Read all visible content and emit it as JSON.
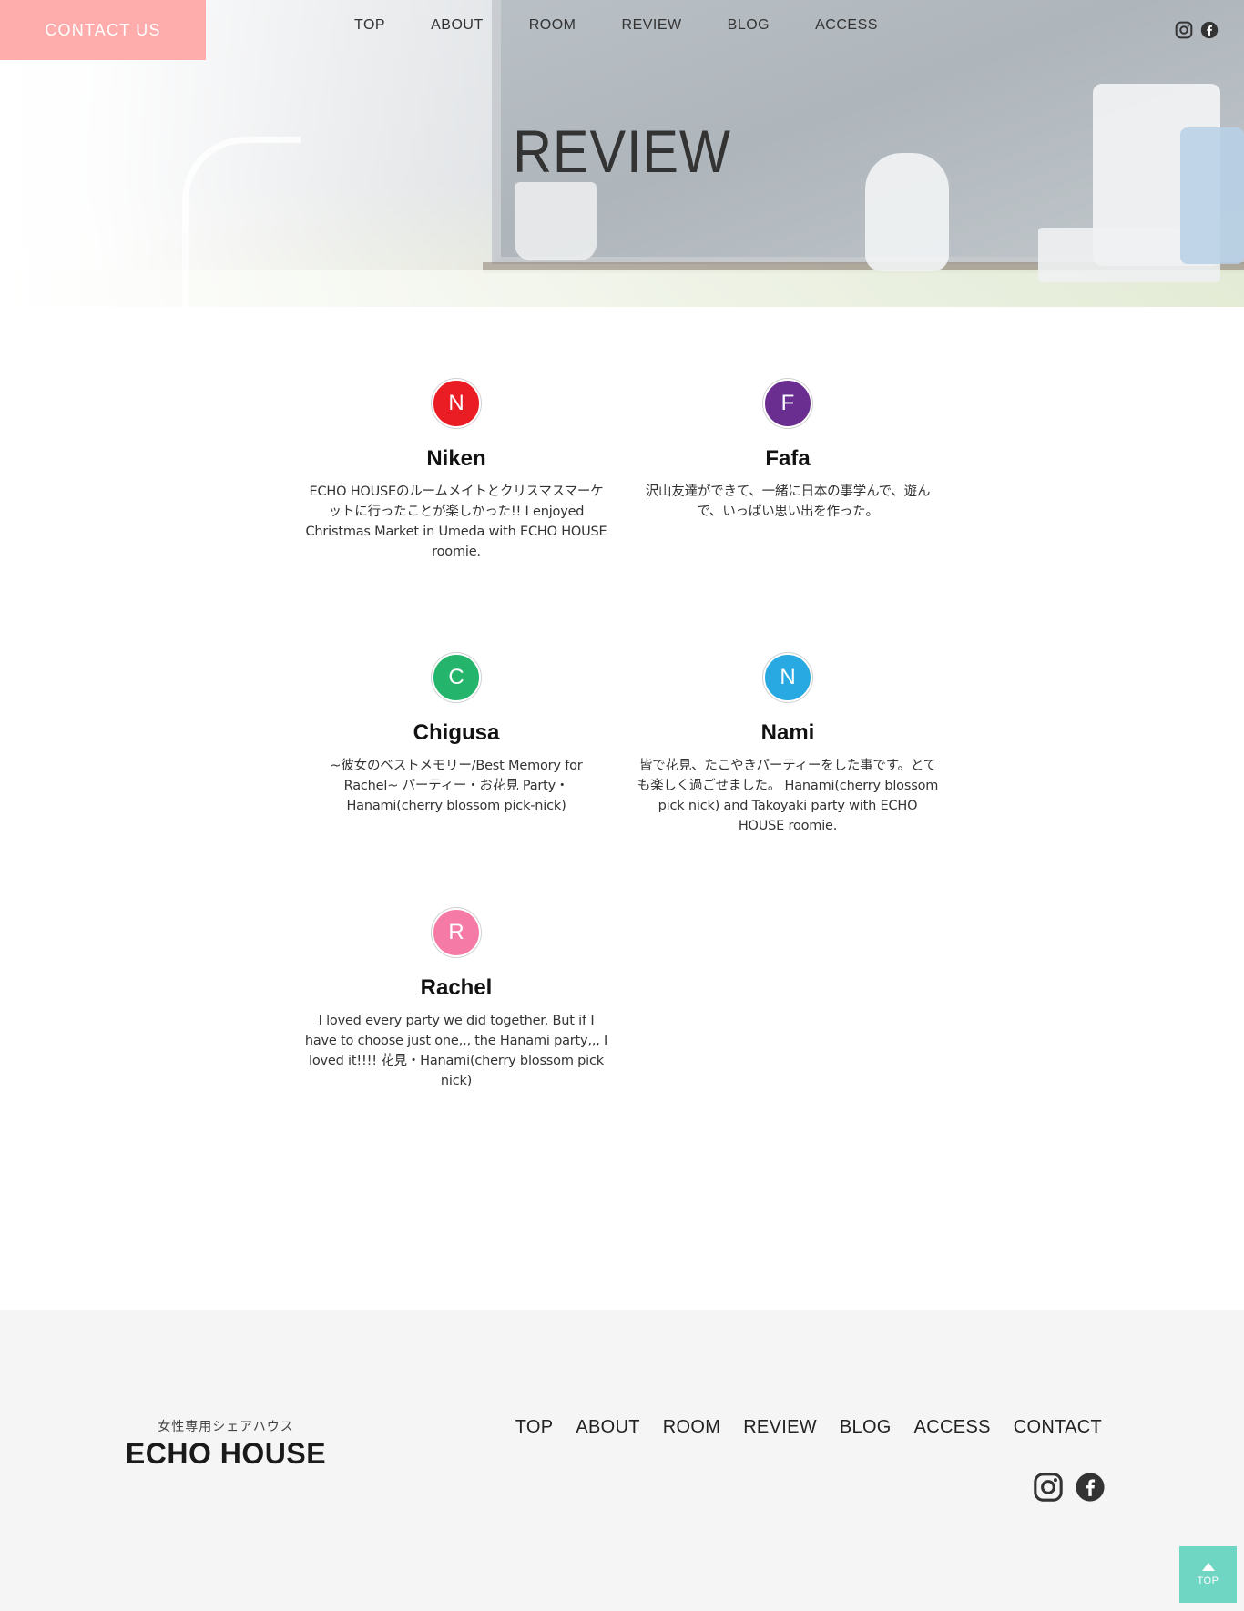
{
  "header": {
    "contact_button": "CONTACT US",
    "nav": [
      "TOP",
      "ABOUT",
      "ROOM",
      "REVIEW",
      "BLOG",
      "ACCESS"
    ],
    "social_icons": [
      "instagram-icon",
      "facebook-icon"
    ]
  },
  "hero": {
    "title": "REVIEW"
  },
  "reviews": [
    {
      "initial": "N",
      "color": "#ea1c24",
      "name": "Niken",
      "text": "ECHO HOUSEのルームメイトとクリスマスマーケットに行ったことが楽しかった!! I enjoyed Christmas Market in Umeda with ECHO HOUSE roomie."
    },
    {
      "initial": "F",
      "color": "#6a2e91",
      "name": "Fafa",
      "text": "沢山友達ができて、一緒に日本の事学んで、遊んで、いっぱい思い出を作った。"
    },
    {
      "initial": "C",
      "color": "#24b46b",
      "name": "Chigusa",
      "text": "~彼女のベストメモリー/Best Memory for Rachel~ パーティー・お花見 Party・Hanami(cherry blossom pick-nick)"
    },
    {
      "initial": "N",
      "color": "#29a9e1",
      "name": "Nami",
      "text": "皆で花見、たこやきパーティーをした事です。とても楽しく過ごせました。 Hanami(cherry blossom pick nick) and Takoyaki party with ECHO HOUSE roomie."
    },
    {
      "initial": "R",
      "color": "#f57ba6",
      "name": "Rachel",
      "text": "I loved every party we did together. But if I have to choose just one,,, the Hanami party,,, I loved it!!!! 花見・Hanami(cherry blossom pick nick)"
    }
  ],
  "footer": {
    "subtitle": "女性専用シェアハウス",
    "logo": "ECHO HOUSE",
    "nav": [
      "TOP",
      "ABOUT",
      "ROOM",
      "REVIEW",
      "BLOG",
      "ACCESS",
      "CONTACT"
    ],
    "social_icons": [
      "instagram-icon",
      "facebook-icon"
    ]
  },
  "back_to_top": "TOP",
  "colors": {
    "contact_button": "#ffacac",
    "back_to_top": "#6fd6c4",
    "footer_bg": "#f5f5f5"
  }
}
